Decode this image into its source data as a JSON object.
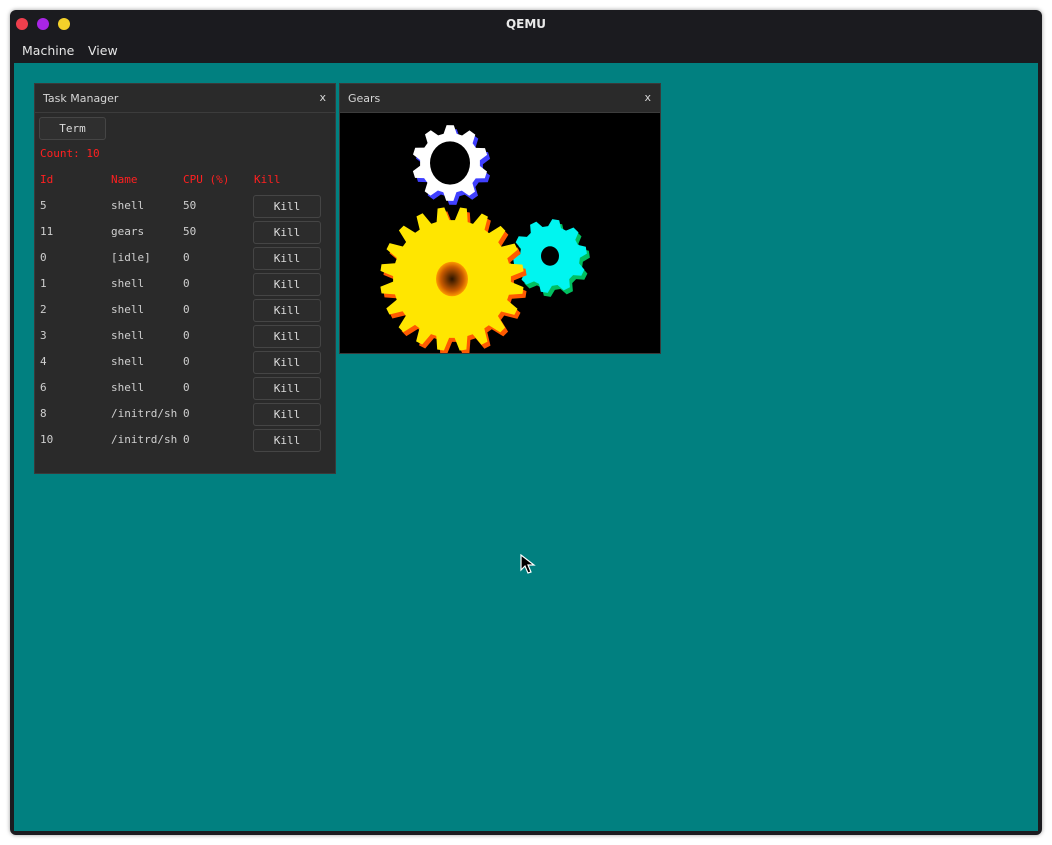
{
  "window": {
    "title": "QEMU",
    "controls": [
      "close",
      "minimize",
      "maximize"
    ],
    "colors": {
      "close": "#ee3f4d",
      "minimize": "#a925e6",
      "maximize": "#f4d12a"
    }
  },
  "menubar": [
    {
      "label": "Machine"
    },
    {
      "label": "View"
    }
  ],
  "desktop": {
    "background": "#018080"
  },
  "task_manager": {
    "title": "Task Manager",
    "close_label": "x",
    "term_label": "Term",
    "count_label": "Count: 10",
    "headers": {
      "id": "Id",
      "name": "Name",
      "cpu": "CPU (%)",
      "kill": "Kill"
    },
    "rows": [
      {
        "id": "5",
        "name": "shell",
        "cpu": "50",
        "kill": "Kill"
      },
      {
        "id": "11",
        "name": "gears",
        "cpu": "50",
        "kill": "Kill"
      },
      {
        "id": "0",
        "name": "[idle]",
        "cpu": "0",
        "kill": "Kill"
      },
      {
        "id": "1",
        "name": "shell",
        "cpu": "0",
        "kill": "Kill"
      },
      {
        "id": "2",
        "name": "shell",
        "cpu": "0",
        "kill": "Kill"
      },
      {
        "id": "3",
        "name": "shell",
        "cpu": "0",
        "kill": "Kill"
      },
      {
        "id": "4",
        "name": "shell",
        "cpu": "0",
        "kill": "Kill"
      },
      {
        "id": "6",
        "name": "shell",
        "cpu": "0",
        "kill": "Kill"
      },
      {
        "id": "8",
        "name": "/initrd/sh",
        "cpu": "0",
        "kill": "Kill"
      },
      {
        "id": "10",
        "name": "/initrd/sh",
        "cpu": "0",
        "kill": "Kill"
      }
    ]
  },
  "gears_window": {
    "title": "Gears",
    "close_label": "x",
    "gear_colors": {
      "large": "#ffe600",
      "medium": "#00f5f0",
      "small": "#ffffff"
    }
  }
}
